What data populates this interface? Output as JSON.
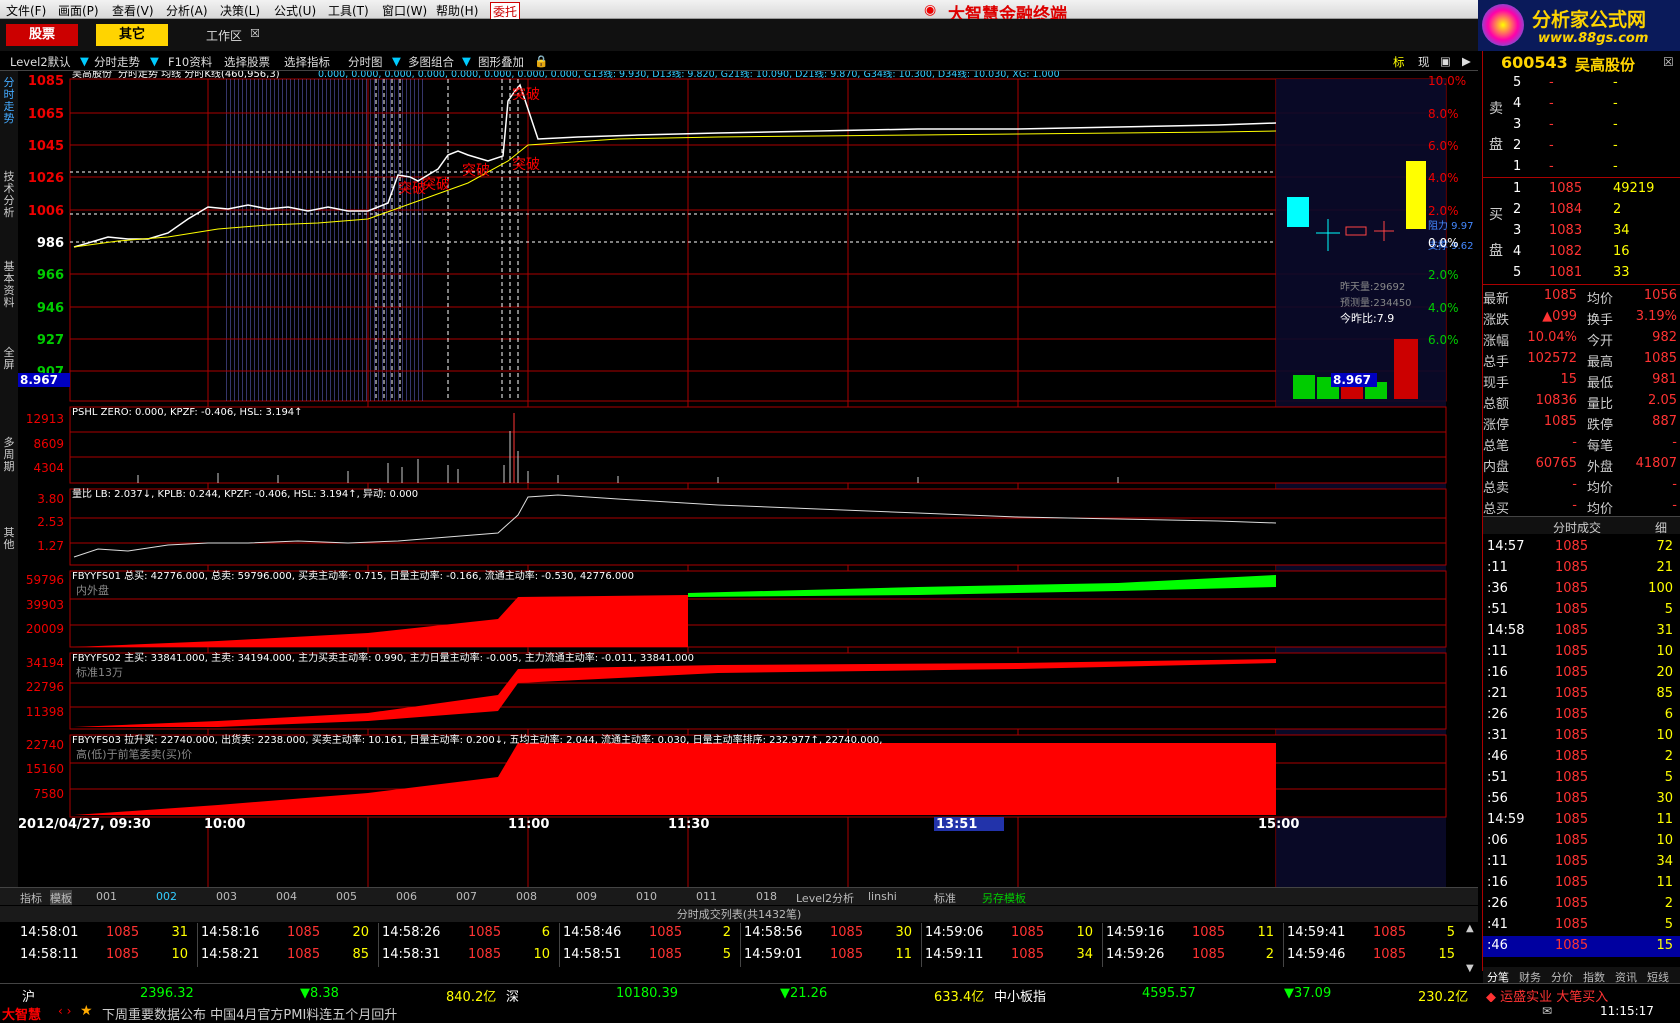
{
  "menu": [
    "文件(F)",
    "画面(P)",
    "查看(V)",
    "分析(A)",
    "决策(L)",
    "公式(U)",
    "工具(T)",
    "窗口(W)",
    "帮助(H)",
    "委托"
  ],
  "app_title": "大智慧金融终端",
  "logo": {
    "title": "分析家公式网",
    "url": "www.88gs.com"
  },
  "toolbar": {
    "stock_btn": "股票",
    "other_btn": "其它",
    "workspace": "工作区"
  },
  "toolbar2": [
    "Level2默认",
    "分时走势",
    "F10资料",
    "选择股票",
    "选择指标",
    "分时图",
    "多图组合",
    "图形叠加"
  ],
  "toolbar2_right": [
    "标",
    "现"
  ],
  "left_tabs": [
    "分时走势",
    "技术分析",
    "基本资料",
    "全屏",
    "多周期",
    "其他"
  ],
  "main_header": {
    "stock": "吴高股份",
    "label": "分时走势 均线 分时K线(460,956,3)",
    "extra": "0.000, 0.000, 0.000, 0.000, 0.000, 0.000, 0.000, 0.000, G13线: 9.930, D13线: 9.820, G21线: 10.090, D21线: 9.870, G34线: 10.300, D34线: 10.030, XG: 1.000"
  },
  "price_axis": [
    "1085",
    "1065",
    "1045",
    "1026",
    "1006",
    "986",
    "966",
    "946",
    "927",
    "907"
  ],
  "pct_axis": [
    "10.0%",
    "8.0%",
    "6.0%",
    "4.0%",
    "2.0%",
    "0.0%",
    "2.0%",
    "4.0%",
    "6.0%"
  ],
  "prev_close_label": "8.967",
  "signals": [
    "突破",
    "突破",
    "突破",
    "突破",
    "突破"
  ],
  "vol_info": {
    "yesterday": "昨天量:29692",
    "forecast": "预测量:234450",
    "ratio": "今昨比:7.9"
  },
  "kline_labels": {
    "a": "阻力 9.97",
    "b": "支撑 9.62"
  },
  "pshl": {
    "header": "PSHL ZERO: 0.000, KPZF: -0.406, HSL: 3.194↑",
    "axis": [
      "12913",
      "8609",
      "4304"
    ]
  },
  "lb": {
    "header": "量比 LB: 2.037↓, KPLB: 0.244, KPZF: -0.406, HSL: 3.194↑, 异动: 0.000",
    "axis": [
      "3.80",
      "2.53",
      "1.27"
    ]
  },
  "fs01": {
    "header": "FBYYFS01 总买: 42776.000, 总卖: 59796.000, 买卖主动率: 0.715, 日量主动率: -0.166, 流通主动率: -0.530, 42776.000",
    "sub": "内外盘",
    "axis": [
      "59796",
      "39903",
      "20009"
    ]
  },
  "fs02": {
    "header": "FBYYFS02 主买: 33841.000, 主卖: 34194.000, 主力买卖主动率: 0.990, 主力日量主动率: -0.005, 主力流通主动率: -0.011, 33841.000",
    "sub": "标准13万",
    "axis": [
      "34194",
      "22796",
      "11398"
    ]
  },
  "fs03": {
    "header": "FBYYFS03 拉升买: 22740.000, 出货卖: 2238.000, 买卖主动率: 10.161, 日量主动率: 0.200↓, 五均主动率: 2.044, 流通主动率: 0.030, 日量主动率排序: 232.977↑, 22740.000,",
    "sub": "高(低)于前笔委卖(买)价",
    "axis": [
      "22740",
      "15160",
      "7580"
    ]
  },
  "time_axis": [
    "2012/04/27, 09:30",
    "10:00",
    "11:00",
    "11:30",
    "13:51",
    "15:00"
  ],
  "bottom_tabs": [
    "指标",
    "模板",
    "001",
    "002",
    "003",
    "004",
    "005",
    "006",
    "007",
    "008",
    "009",
    "010",
    "011",
    "018",
    "Level2分析",
    "linshi",
    "标准",
    "另存模板"
  ],
  "tick_title": "分时成交列表(共1432笔)",
  "ticks": [
    [
      "14:58:01",
      "1085",
      "31"
    ],
    [
      "14:58:11",
      "1085",
      "10"
    ],
    [
      "14:58:16",
      "1085",
      "20"
    ],
    [
      "14:58:21",
      "1085",
      "85"
    ],
    [
      "14:58:26",
      "1085",
      "6"
    ],
    [
      "14:58:31",
      "1085",
      "10"
    ],
    [
      "14:58:46",
      "1085",
      "2"
    ],
    [
      "14:58:51",
      "1085",
      "5"
    ],
    [
      "14:58:56",
      "1085",
      "30"
    ],
    [
      "14:59:01",
      "1085",
      "11"
    ],
    [
      "14:59:06",
      "1085",
      "10"
    ],
    [
      "14:59:11",
      "1085",
      "34"
    ],
    [
      "14:59:16",
      "1085",
      "11"
    ],
    [
      "14:59:26",
      "1085",
      "2"
    ],
    [
      "14:59:41",
      "1085",
      "5"
    ],
    [
      "14:59:46",
      "1085",
      "15"
    ]
  ],
  "quote": {
    "code": "600543",
    "name": "吴高股份",
    "sell_label": "卖盘",
    "buy_label": "买盘",
    "sell": [
      [
        "5",
        "-",
        "-"
      ],
      [
        "4",
        "-",
        "-"
      ],
      [
        "3",
        "-",
        "-"
      ],
      [
        "2",
        "-",
        "-"
      ],
      [
        "1",
        "-",
        "-"
      ]
    ],
    "buy": [
      [
        "1",
        "1085",
        "49219"
      ],
      [
        "2",
        "1084",
        "2"
      ],
      [
        "3",
        "1083",
        "34"
      ],
      [
        "4",
        "1082",
        "16"
      ],
      [
        "5",
        "1081",
        "33"
      ]
    ],
    "stats": [
      [
        "最新",
        "1085",
        "均价",
        "1056"
      ],
      [
        "涨跌",
        "▲099",
        "换手",
        "3.19%"
      ],
      [
        "涨幅",
        "10.04%",
        "今开",
        "982"
      ],
      [
        "总手",
        "102572",
        "最高",
        "1085"
      ],
      [
        "现手",
        "15",
        "最低",
        "981"
      ],
      [
        "总额",
        "10836",
        "量比",
        "2.05"
      ],
      [
        "涨停",
        "1085",
        "跌停",
        "887"
      ],
      [
        "总笔",
        "-",
        "每笔",
        "-"
      ],
      [
        "内盘",
        "60765",
        "外盘",
        "41807"
      ],
      [
        "总卖",
        "-",
        "均价",
        "-"
      ],
      [
        "总买",
        "-",
        "均价",
        "-"
      ]
    ],
    "ts_title": "分时成交",
    "ts_btn": "细",
    "ts": [
      [
        "14:57",
        "1085",
        "72"
      ],
      [
        ":11",
        "1085",
        "21"
      ],
      [
        ":36",
        "1085",
        "100"
      ],
      [
        ":51",
        "1085",
        "5"
      ],
      [
        "14:58",
        "1085",
        "31"
      ],
      [
        ":11",
        "1085",
        "10"
      ],
      [
        ":16",
        "1085",
        "20"
      ],
      [
        ":21",
        "1085",
        "85"
      ],
      [
        ":26",
        "1085",
        "6"
      ],
      [
        ":31",
        "1085",
        "10"
      ],
      [
        ":46",
        "1085",
        "2"
      ],
      [
        ":51",
        "1085",
        "5"
      ],
      [
        ":56",
        "1085",
        "30"
      ],
      [
        "14:59",
        "1085",
        "11"
      ],
      [
        ":06",
        "1085",
        "10"
      ],
      [
        ":11",
        "1085",
        "34"
      ],
      [
        ":16",
        "1085",
        "11"
      ],
      [
        ":26",
        "1085",
        "2"
      ],
      [
        ":41",
        "1085",
        "5"
      ],
      [
        ":46",
        "1085",
        "15"
      ]
    ],
    "tabs": [
      "分笔",
      "财务",
      "分价",
      "指数",
      "资讯",
      "短线"
    ]
  },
  "ticker": {
    "sh": "沪",
    "sh_val": "2396.32",
    "sh_chg": "▼8.38",
    "sh_amt": "840.2亿",
    "sz": "深",
    "sz_val": "10180.39",
    "sz_chg": "▼21.26",
    "sz_amt": "633.4亿",
    "zx": "中小板指",
    "zx_val": "4595.57",
    "zx_chg": "▼37.09",
    "zx_amt": "230.2亿",
    "alert": "◆ 运盛实业 大笔买入"
  },
  "news": {
    "brand": "大智慧",
    "text": "下周重要数据公布 中国4月官方PMI料连五个月回升",
    "clock": "11:15:17"
  }
}
